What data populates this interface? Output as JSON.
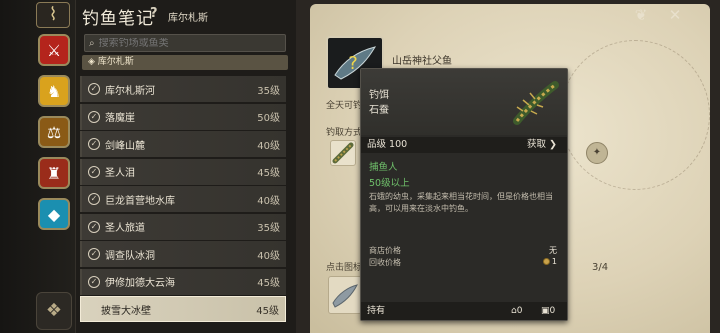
{
  "header": {
    "back_icon": "fish-hook-icon",
    "title": "钓鱼笔记",
    "help": "?",
    "region": "库尔札斯"
  },
  "rail": {
    "items": [
      {
        "icon": "battle-crest-icon",
        "color": "#b4241c"
      },
      {
        "icon": "chocobo-icon",
        "color": "#d9a21d"
      },
      {
        "icon": "scales-icon",
        "color": "#8a5a16"
      },
      {
        "icon": "lantern-icon",
        "color": "#9a2c1a"
      },
      {
        "icon": "crystal-icon",
        "color": "#1b8fb0"
      }
    ],
    "bottom_icon": "journal-icon"
  },
  "search": {
    "placeholder": "搜索钓场或鱼类"
  },
  "region_chip": "◈ 库尔札斯",
  "spots": [
    {
      "name": "库尔札斯河",
      "level": "35级",
      "done": true
    },
    {
      "name": "落魔崖",
      "level": "50级",
      "done": true
    },
    {
      "name": "剑峰山麓",
      "level": "40级",
      "done": true
    },
    {
      "name": "圣人泪",
      "level": "45级",
      "done": true
    },
    {
      "name": "巨龙首营地水库",
      "level": "40级",
      "done": true
    },
    {
      "name": "圣人旅道",
      "level": "35级",
      "done": true
    },
    {
      "name": "调查队冰洞",
      "level": "40级",
      "done": true
    },
    {
      "name": "伊修加德大云海",
      "level": "45级",
      "done": true
    },
    {
      "name": "披雪大冰壁",
      "level": "45级",
      "done": false,
      "active": true
    }
  ],
  "book": {
    "fish_name": "山岳神社父鱼",
    "avail_label": "全天可钓",
    "method_label": "钓取方式",
    "click_hint": "点击图标",
    "page": "3/4"
  },
  "tooltip": {
    "type": "钓饵",
    "name": "石蚕",
    "grade": "品级 100",
    "get": "获取",
    "req_job": "捕鱼人",
    "req_level": "50级以上",
    "desc": "石蛾的幼虫，采集起来相当花时间，但是价格也相当高，可以用来在淡水中钓鱼。",
    "shop_label": "商店价格",
    "shop_value": "无",
    "sell_label": "回收价格",
    "sell_value": "1",
    "own_label": "持有",
    "own_home": "0",
    "own_bag": "0"
  },
  "colors": {
    "accent_green": "#6fbf6a",
    "paper": "#ddd2b6"
  }
}
